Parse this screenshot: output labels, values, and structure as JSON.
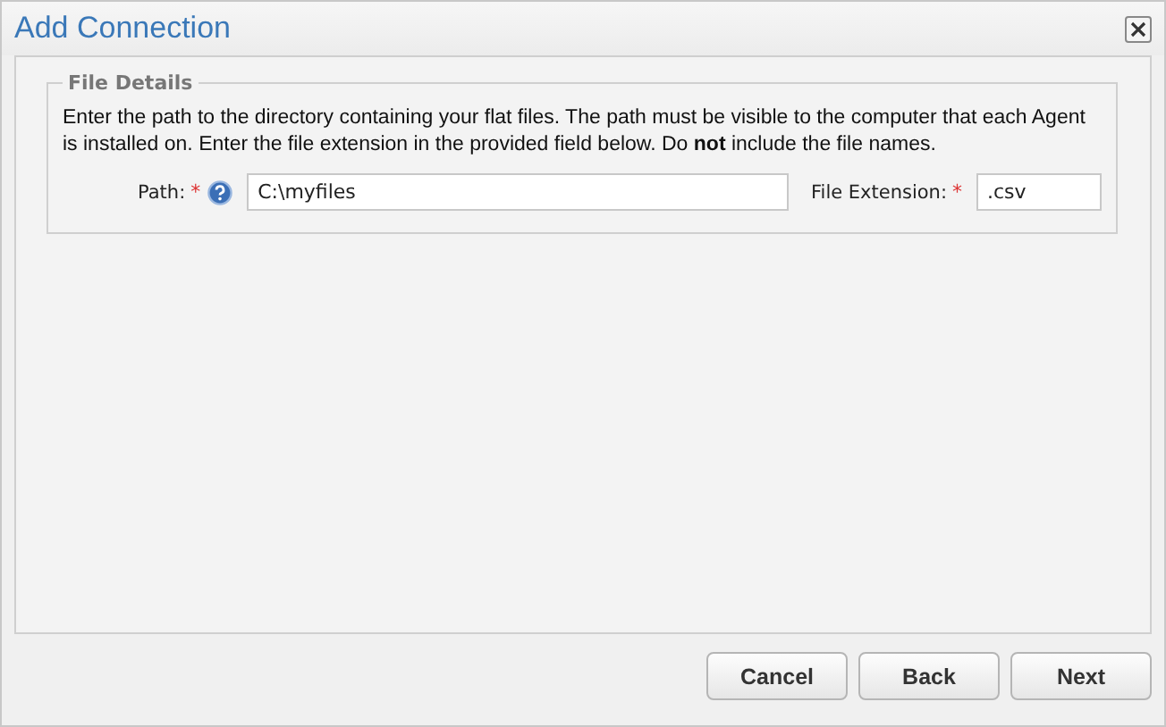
{
  "window": {
    "title": "Add Connection"
  },
  "fieldset": {
    "legend": "File Details",
    "instructions": "Enter the path to the directory containing your flat files. The path must be visible to the computer that each Agent is installed on. Enter the file extension in the provided field below. Do **not** include the file names.",
    "fields": [
      {
        "label": "Path:",
        "required_mark": "*",
        "help": true,
        "value": "C:\\myfiles",
        "kind": "wide"
      },
      {
        "label": "File Extension:",
        "required_mark": "*",
        "help": false,
        "value": ".csv",
        "kind": "narrow"
      }
    ]
  },
  "buttons": [
    "Cancel",
    "Back",
    "Next"
  ]
}
